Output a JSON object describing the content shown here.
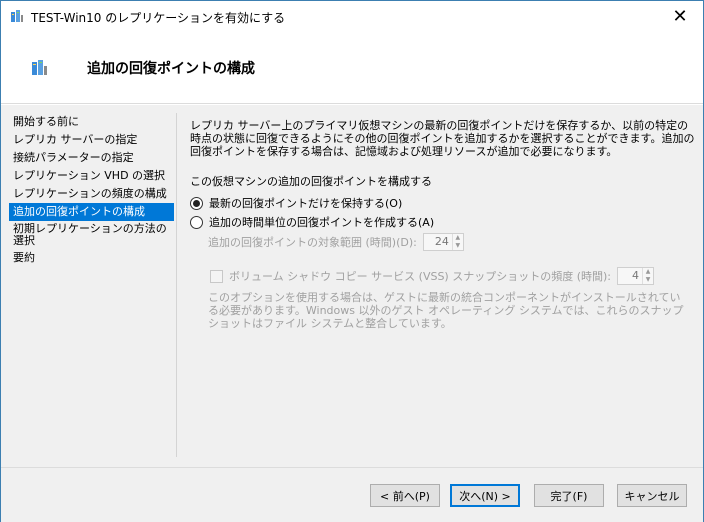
{
  "window": {
    "title": "TEST-Win10 のレプリケーションを有効にする",
    "close_glyph": "✕"
  },
  "header": {
    "title": "追加の回復ポイントの構成"
  },
  "nav": {
    "items": [
      {
        "label": "開始する前に",
        "selected": false
      },
      {
        "label": "レプリカ サーバーの指定",
        "selected": false
      },
      {
        "label": "接続パラメーターの指定",
        "selected": false
      },
      {
        "label": "レプリケーション VHD の選択",
        "selected": false
      },
      {
        "label": "レプリケーションの頻度の構成",
        "selected": false
      },
      {
        "label": "追加の回復ポイントの構成",
        "selected": true
      },
      {
        "label": "初期レプリケーションの方法の選択",
        "selected": false
      },
      {
        "label": "要約",
        "selected": false
      }
    ]
  },
  "main": {
    "description": "レプリカ サーバー上のプライマリ仮想マシンの最新の回復ポイントだけを保存するか、以前の特定の時点の状態に回復できるようにその他の回復ポイントを追加するかを選択することができます。追加の回復ポイントを保存する場合は、記憶域および処理リソースが追加で必要になります。",
    "section_label": "この仮想マシンの追加の回復ポイントを構成する",
    "option_latest": "最新の回復ポイントだけを保持する(O)",
    "option_hourly": "追加の時間単位の回復ポイントを作成する(A)",
    "selected_option": "latest",
    "range_label": "追加の回復ポイントの対象範囲 (時間)(D):",
    "range_value": "24",
    "vss_label": "ボリューム シャドウ コピー サービス (VSS) スナップショットの頻度 (時間):",
    "vss_value": "4",
    "note": "このオプションを使用する場合は、ゲストに最新の統合コンポーネントがインストールされている必要があります。Windows 以外のゲスト オペレーティング システムでは、これらのスナップショットはファイル システムと整合しています。"
  },
  "footer": {
    "back": "< 前へ(P)",
    "next": "次へ(N) >",
    "finish": "完了(F)",
    "cancel": "キャンセル"
  },
  "colors": {
    "accent": "#0078d7",
    "panel": "#f0f0f0"
  }
}
